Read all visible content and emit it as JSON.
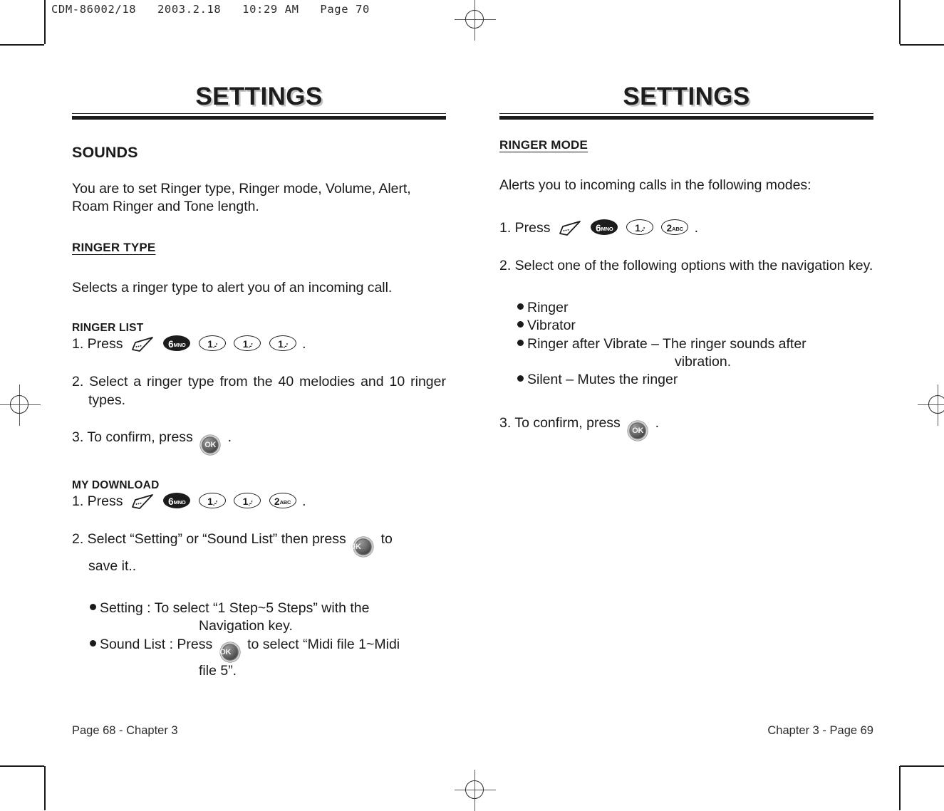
{
  "slug": "CDM-86002/18   2003.2.18   10:29 AM   Page 70",
  "icons": {
    "menu": "menu-softkey-icon",
    "ok": "ok-button-icon",
    "key6": "key-6-mno-icon",
    "key1": "key-1-icon",
    "key2": "key-2-abc-icon"
  },
  "keys": {
    "six_num": "6",
    "six_letters": "MNO",
    "one_num": "1",
    "one_tick": ".-'",
    "two_num": "2",
    "two_letters": "ABC",
    "ok_label": "OK"
  },
  "left_page": {
    "title": "SETTINGS",
    "section_heading": "SOUNDS",
    "intro": "You are to set Ringer type, Ringer mode, Volume, Alert, Roam Ringer and Tone length.",
    "ringer_type_heading": "RINGER TYPE",
    "ringer_type_desc": "Selects a ringer type to alert you of an incoming call.",
    "ringer_list_heading": "RINGER LIST",
    "ringer_list_step1_pre": "1. Press",
    "ringer_list_step1_post": ".",
    "ringer_list_step2": "2. Select a ringer type from the 40 melodies and 10 ringer types.",
    "ringer_list_step3_pre": "3. To confirm, press",
    "ringer_list_step3_post": ".",
    "my_download_heading": "MY DOWNLOAD",
    "my_download_step1_pre": "1. Press",
    "my_download_step1_post": ".",
    "my_download_step2_pre": "2. Select “Setting” or “Sound List” then press",
    "my_download_step2_post": "to",
    "my_download_step2_line2": "save it..",
    "bullets": [
      {
        "text": "Setting : To select “1 Step~5 Steps” with the",
        "continuation": "Navigation key.",
        "has_ok": false
      },
      {
        "text_pre": "Sound List : Press",
        "text_post": "to select “Midi file 1~Midi",
        "continuation": "file 5”.",
        "has_ok": true
      }
    ],
    "footer": "Page 68 - Chapter 3"
  },
  "right_page": {
    "title": "SETTINGS",
    "ringer_mode_heading": "RINGER MODE",
    "ringer_mode_desc": "Alerts you to incoming calls in the following modes:",
    "step1_pre": "1. Press",
    "step1_post": ".",
    "step2": "2. Select one of the following options with the navigation key.",
    "bullets": [
      {
        "text": "Ringer",
        "continuation": ""
      },
      {
        "text": "Vibrator",
        "continuation": ""
      },
      {
        "text": "Ringer after Vibrate – The ringer sounds after",
        "continuation": "vibration."
      },
      {
        "text": "Silent – Mutes the ringer",
        "continuation": ""
      }
    ],
    "step3_pre": "3. To confirm, press",
    "step3_post": ".",
    "footer": "Chapter 3 - Page 69"
  },
  "colors": {
    "ink": "#1a1a1a",
    "title_shadow": "#c3c3c3",
    "key_dark": "#1c1c1c"
  }
}
